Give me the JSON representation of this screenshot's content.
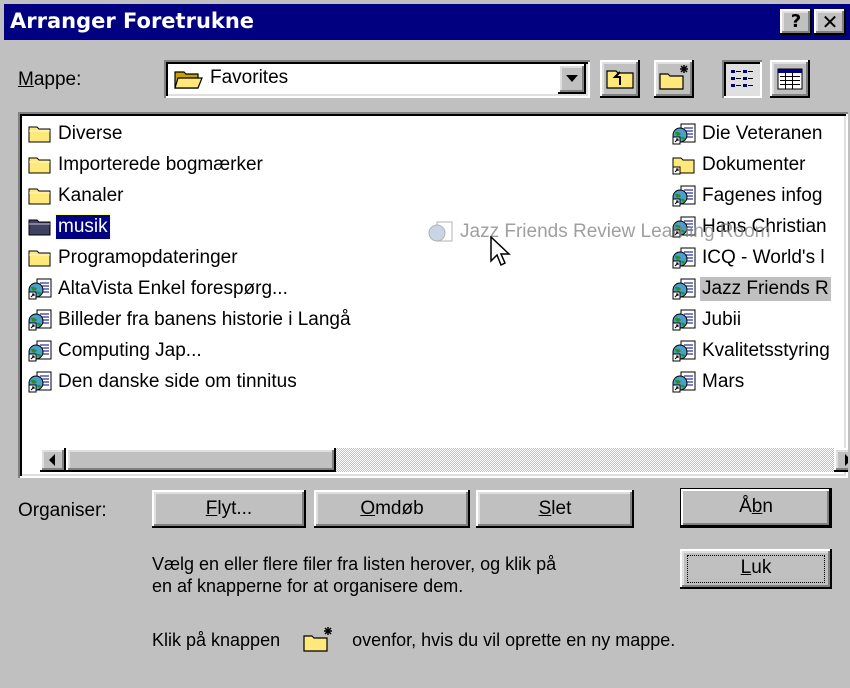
{
  "window": {
    "title": "Arranger Foretrukne",
    "help_button": "?",
    "close_button": "✕"
  },
  "folder_label": "Mappe:",
  "folder_combo": {
    "value": "Favorites"
  },
  "toolbar": {
    "up_icon": "up-one-level-icon",
    "new_folder_icon": "new-folder-icon",
    "list_view_icon": "list-view-icon",
    "details_view_icon": "details-view-icon"
  },
  "list": {
    "left_column": [
      {
        "label": "Diverse",
        "icon": "folder-icon"
      },
      {
        "label": "Importerede bogmærker",
        "icon": "folder-icon"
      },
      {
        "label": "Kanaler",
        "icon": "folder-icon"
      },
      {
        "label": "musik",
        "icon": "folder-icon"
      },
      {
        "label": "Programopdateringer",
        "icon": "folder-icon"
      },
      {
        "label": "AltaVista Enkel forespørg...",
        "icon": "internet-shortcut-icon"
      },
      {
        "label": "Billeder fra banens historie i Langå",
        "icon": "internet-shortcut-icon"
      },
      {
        "label": "Computing Jap...",
        "icon": "internet-shortcut-icon"
      },
      {
        "label": "Den danske side om tinnitus",
        "icon": "internet-shortcut-icon"
      }
    ],
    "right_column": [
      {
        "label": "Die Veteranen",
        "icon": "internet-shortcut-icon"
      },
      {
        "label": "Dokumenter",
        "icon": "shortcut-folder-icon"
      },
      {
        "label": "Fagenes infog",
        "icon": "internet-shortcut-icon"
      },
      {
        "label": "Hans Christian",
        "icon": "internet-shortcut-icon"
      },
      {
        "label": "ICQ - World's l",
        "icon": "internet-shortcut-icon"
      },
      {
        "label": "Jazz Friends R",
        "icon": "internet-shortcut-icon"
      },
      {
        "label": "Jubii",
        "icon": "internet-shortcut-icon"
      },
      {
        "label": "Kvalitetsstyring",
        "icon": "internet-shortcut-icon"
      },
      {
        "label": "Mars",
        "icon": "internet-shortcut-icon"
      }
    ],
    "selected_item": "musik",
    "drag_ghost": "Jazz Friends Review Learning Room"
  },
  "organize_label": "Organiser:",
  "buttons": {
    "move": "Flyt...",
    "rename": "Omdøb",
    "delete": "Slet",
    "open": "Åbn",
    "close": "Luk"
  },
  "instructions": {
    "line1": "Vælg en eller flere filer fra listen herover, og klik på",
    "line2": "en af knapperne for at organisere dem.",
    "line3_before": "Klik på knappen",
    "line3_after": "ovenfor, hvis du vil oprette en ny mappe."
  },
  "colors": {
    "titlebar": "#000080",
    "face": "#c0c0c0",
    "selection": "#000080"
  }
}
